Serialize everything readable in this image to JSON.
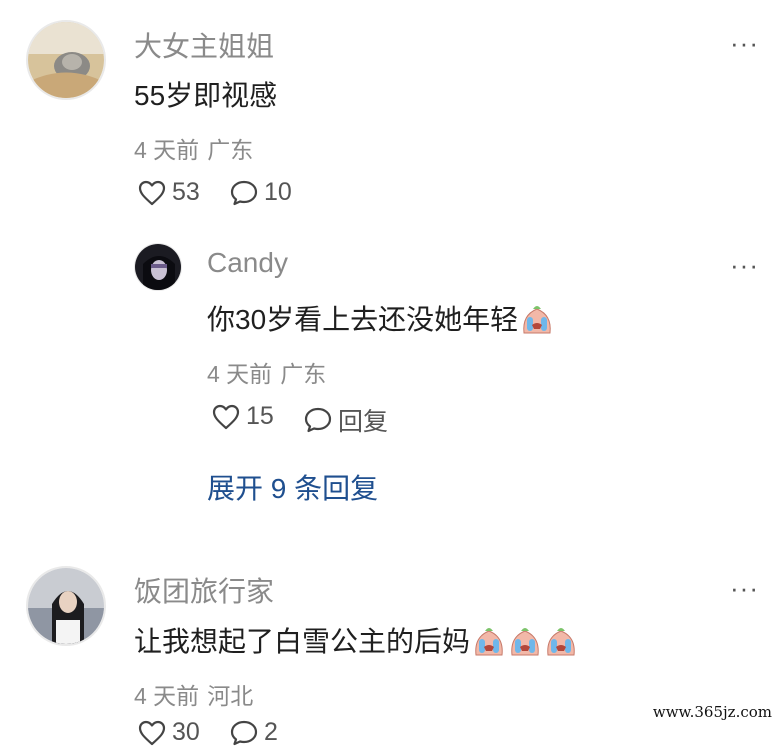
{
  "comments": [
    {
      "author": "大女主姐姐",
      "text": "55岁即视感",
      "time": "4 天前",
      "location": "广东",
      "likes": "53",
      "replies": "10",
      "more": "···",
      "sub": {
        "author": "Candy",
        "text": "你30岁看上去还没她年轻",
        "time": "4 天前",
        "location": "广东",
        "likes": "15",
        "reply_label": "回复",
        "more": "···"
      },
      "expand_label": "展开 9 条回复"
    },
    {
      "author": "饭团旅行家",
      "text": "让我想起了白雪公主的后妈",
      "time": "4 天前",
      "location": "河北",
      "likes": "30",
      "replies": "2",
      "more": "···"
    }
  ],
  "watermark": "www.365jz.com",
  "icons": {
    "like": "heart-icon",
    "comment": "comment-bubble-icon",
    "more": "more-dots-icon",
    "emoji_crying": "crying-face-emoji"
  },
  "colors": {
    "link": "#1f4f8f",
    "muted": "#8a8a8a",
    "text": "#1f1f1f"
  }
}
